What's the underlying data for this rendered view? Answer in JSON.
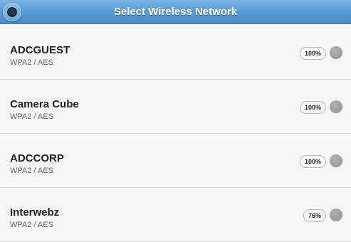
{
  "header": {
    "title": "Select Wireless Network",
    "back_icon": "back-circle-icon",
    "color": "#5a9bd5"
  },
  "networks": [
    {
      "name": "ADCGUEST",
      "security": "WPA2 / AES",
      "signal": "100%",
      "status_icon": "status-dot-icon"
    },
    {
      "name": "Camera Cube",
      "security": "WPA2 / AES",
      "signal": "100%",
      "status_icon": "status-dot-icon"
    },
    {
      "name": "ADCCORP",
      "security": "WPA2 / AES",
      "signal": "100%",
      "status_icon": "status-dot-icon"
    },
    {
      "name": "Interwebz",
      "security": "WPA2 / AES",
      "signal": "76%",
      "status_icon": "status-dot-icon"
    }
  ]
}
